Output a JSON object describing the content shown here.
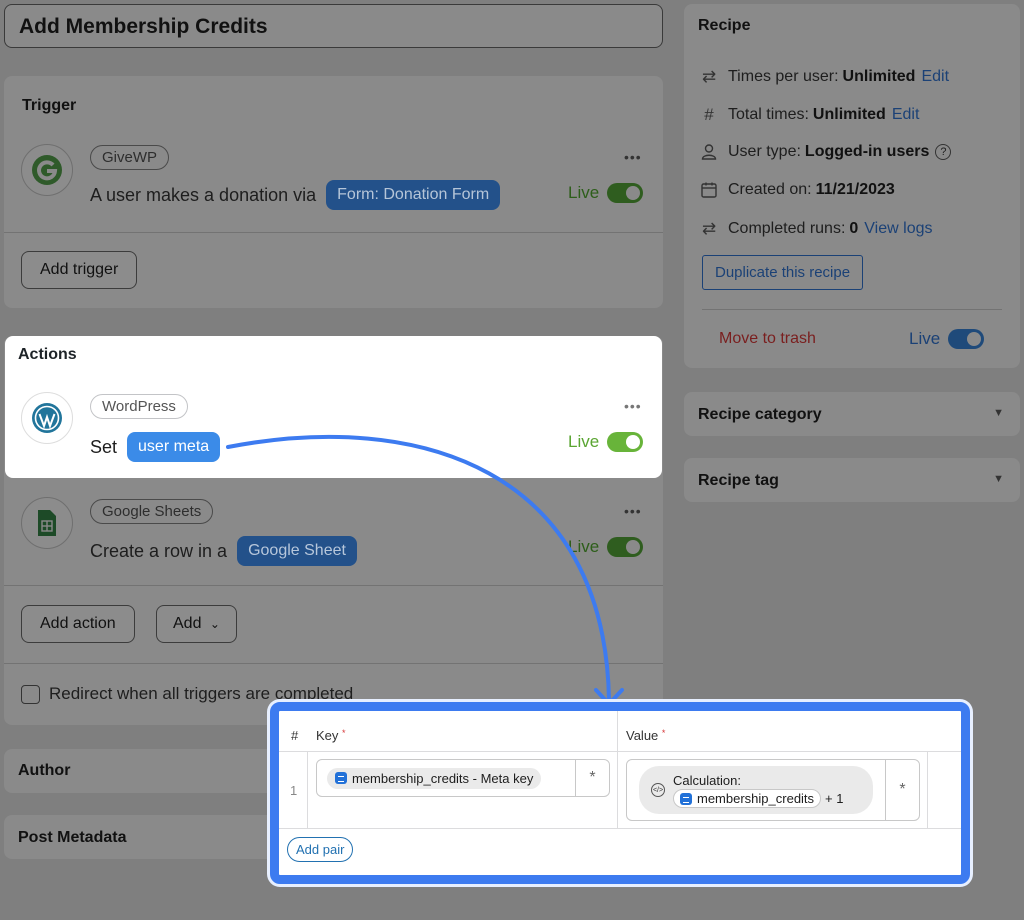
{
  "recipe_title": "Add Membership Credits",
  "trigger": {
    "heading": "Trigger",
    "integration": "GiveWP",
    "sentence_prefix": "A user makes a donation via",
    "token": "Form: Donation Form",
    "menu": "•••",
    "status": "Live",
    "add_button": "Add trigger"
  },
  "actions": {
    "heading": "Actions",
    "items": [
      {
        "integration": "WordPress",
        "sentence_prefix": "Set",
        "token": "user meta",
        "menu": "•••",
        "status": "Live"
      },
      {
        "integration": "Google Sheets",
        "sentence_prefix": "Create a row in a",
        "token": "Google Sheet",
        "menu": "•••",
        "status": "Live"
      }
    ],
    "add_action": "Add action",
    "add_dropdown": "Add",
    "redirect_label": "Redirect when all triggers are completed"
  },
  "author": {
    "heading": "Author"
  },
  "post_metadata": {
    "heading": "Post Metadata"
  },
  "sidebar": {
    "recipe_heading": "Recipe",
    "times_per_user_label": "Times per user:",
    "times_per_user_value": "Unlimited",
    "times_per_user_edit": "Edit",
    "total_times_label": "Total times:",
    "total_times_value": "Unlimited",
    "total_times_edit": "Edit",
    "user_type_label": "User type:",
    "user_type_value": "Logged-in users",
    "created_label": "Created on:",
    "created_value": "11/21/2023",
    "runs_label": "Completed runs:",
    "runs_value": "0",
    "runs_link": "View logs",
    "duplicate": "Duplicate this recipe",
    "trash": "Move to trash",
    "status": "Live",
    "category_heading": "Recipe category",
    "tag_heading": "Recipe tag"
  },
  "meta_table": {
    "col_index": "#",
    "col_key": "Key",
    "col_value": "Value",
    "required_mark": "*",
    "row_index": "1",
    "key_token": "membership_credits - Meta key",
    "value_label": "Calculation:",
    "value_token": "membership_credits",
    "value_suffix": "+ 1",
    "asterisk": "*",
    "add_pair": "Add pair"
  },
  "colors": {
    "accent_blue": "#3d7bf0",
    "live_green": "#68b43a",
    "trash_red": "#8b2a2a"
  }
}
